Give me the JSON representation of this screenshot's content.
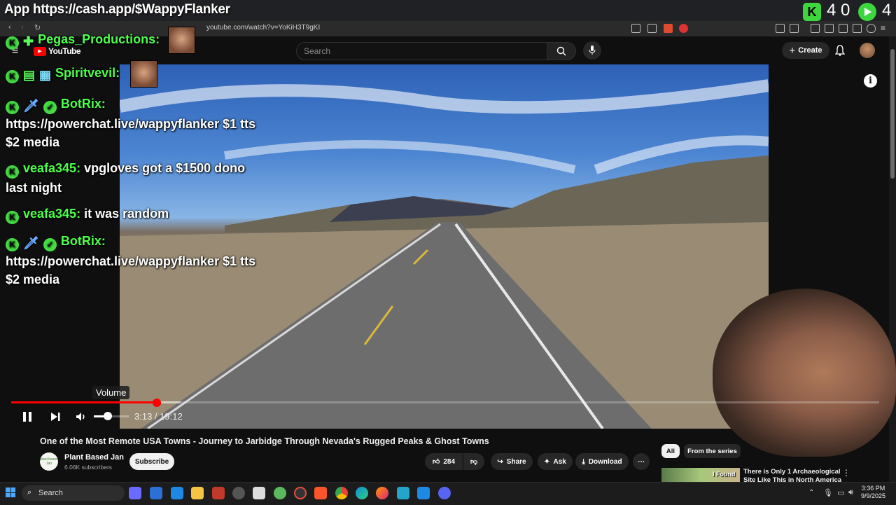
{
  "overlay": {
    "app_title": "App https://cash.app/$WappyFlanker",
    "counter_a": "4 0",
    "counter_b": "4"
  },
  "browser": {
    "url": "youtube.com/watch?v=YoKiH3T9gKI"
  },
  "youtube": {
    "logo_text": "YouTube",
    "search_placeholder": "Search",
    "create_label": "Create",
    "video": {
      "title": "One of the Most Remote USA Towns - Journey to Jarbidge Through Nevada's Rugged Peaks & Ghost Towns",
      "current_time": "3:13",
      "duration": "19:12",
      "time_display": "3:13 / 19:12",
      "progress_fraction": 0.168,
      "buffered_fraction": 0.195,
      "volume_fraction": 0.4,
      "tooltip": "Volume"
    },
    "channel": {
      "name": "Plant Based Jan",
      "subscribers": "6.06K subscribers",
      "avatar_text": "plant based Jan",
      "subscribe_label": "Subscribe"
    },
    "actions": {
      "likes": "284",
      "share": "Share",
      "ask": "Ask",
      "download": "Download"
    },
    "chips": [
      "All",
      "From the series"
    ],
    "recommendation": {
      "thumb_text": "I Found",
      "title": "There is Only 1 Archaeological Site Like This in North America"
    }
  },
  "chat": [
    {
      "user": "Pegas_Productions:",
      "text": ""
    },
    {
      "user": "Spiritvevil:",
      "text": ""
    },
    {
      "user": "BotRix:",
      "text": "https://powerchat.live/wappyflanker $1 tts",
      "text2": "$2 media"
    },
    {
      "user": "veafa345:",
      "text": "vpgloves got a $1500 dono",
      "text2": "last night"
    },
    {
      "user": "veafa345:",
      "text": "it was random"
    },
    {
      "user": "BotRix:",
      "text": "https://powerchat.live/wappyflanker $1 tts",
      "text2": "$2 media"
    }
  ],
  "taskbar": {
    "search_label": "Search",
    "time": "3:36 PM",
    "date": "9/9/2025"
  },
  "colors": {
    "youtube_red": "#ff0000",
    "kick_green": "#44dd44",
    "chat_username": "#4dff4d"
  }
}
